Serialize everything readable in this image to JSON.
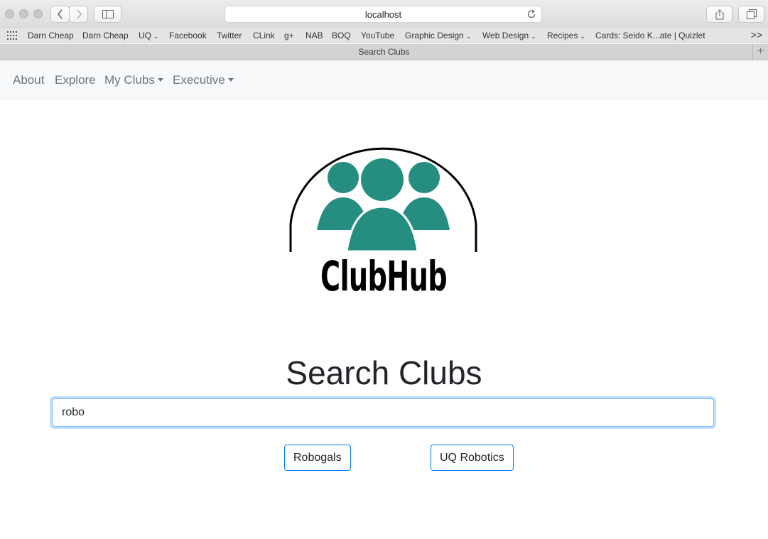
{
  "browser": {
    "address": "localhost",
    "tab_title": "Search Clubs",
    "bookmarks": [
      {
        "label": "Darn Cheap",
        "dropdown": false
      },
      {
        "label": "Darn Cheap",
        "dropdown": false
      },
      {
        "label": "UQ",
        "dropdown": true
      },
      {
        "label": "Facebook",
        "dropdown": false
      },
      {
        "label": "Twitter",
        "dropdown": false
      },
      {
        "label": "CLink",
        "dropdown": false
      },
      {
        "label": "g+",
        "dropdown": false
      },
      {
        "label": "NAB",
        "dropdown": false
      },
      {
        "label": "BOQ",
        "dropdown": false
      },
      {
        "label": "YouTube",
        "dropdown": false
      },
      {
        "label": "Graphic Design",
        "dropdown": true
      },
      {
        "label": "Web Design",
        "dropdown": true
      },
      {
        "label": "Recipes",
        "dropdown": true
      },
      {
        "label": "Cards: Seido K...ate | Quizlet",
        "dropdown": false
      }
    ],
    "more": ">>",
    "new_tab": "+"
  },
  "nav": {
    "about": "About",
    "explore": "Explore",
    "my_clubs": "My Clubs",
    "executive": "Executive"
  },
  "logo": {
    "text": "ClubHub",
    "color": "#268e80"
  },
  "main": {
    "heading": "Search Clubs",
    "search_value": "robo",
    "results": [
      "Robogals",
      "UQ Robotics"
    ]
  }
}
